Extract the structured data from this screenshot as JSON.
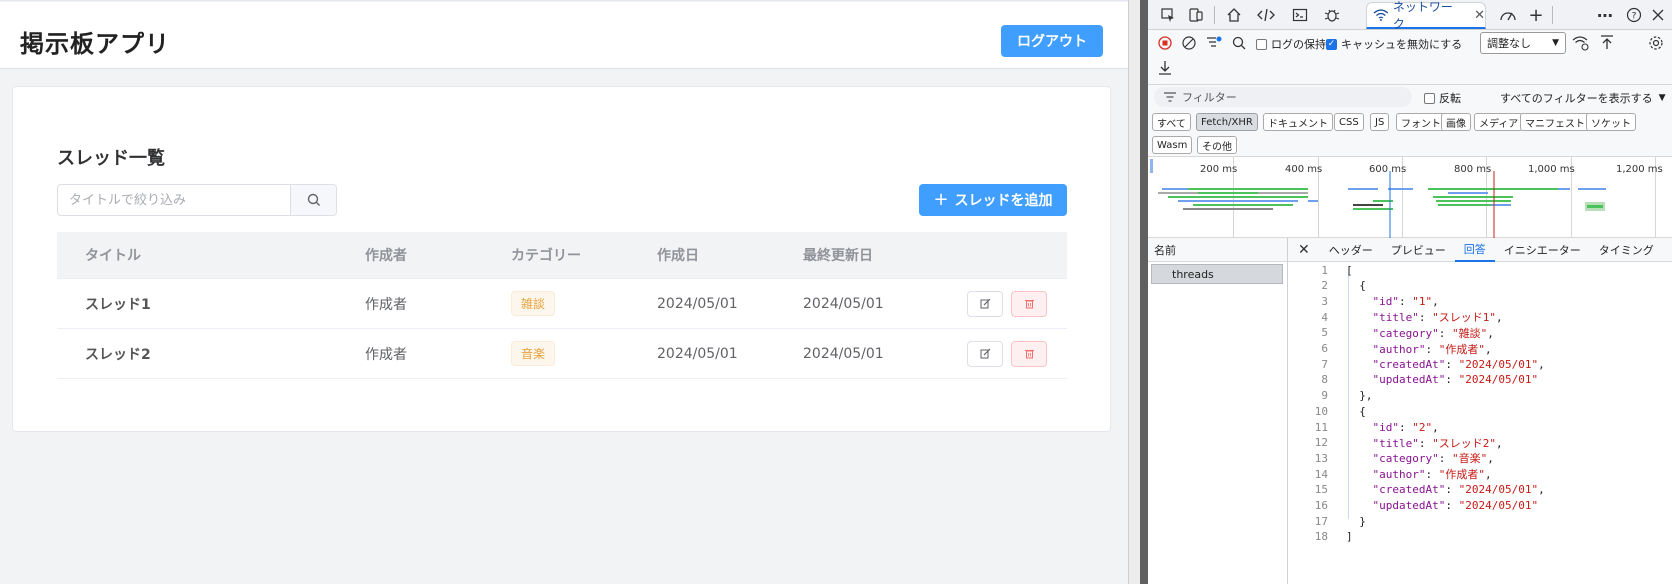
{
  "app": {
    "title": "掲示板アプリ",
    "logout_label": "ログアウト",
    "section_title": "スレッド一覧",
    "search_placeholder": "タイトルで絞り込み",
    "add_label": "スレッドを追加",
    "columns": [
      "タイトル",
      "作成者",
      "カテゴリー",
      "作成日",
      "最終更新日"
    ],
    "rows": [
      {
        "title": "スレッド1",
        "author": "作成者",
        "category": "雑談",
        "created": "2024/05/01",
        "updated": "2024/05/01"
      },
      {
        "title": "スレッド2",
        "author": "作成者",
        "category": "音楽",
        "created": "2024/05/01",
        "updated": "2024/05/01"
      }
    ],
    "accent_color": "#409eff"
  },
  "devtools": {
    "active_tab": "ネットワーク",
    "preserve_log": "ログの保持",
    "disable_cache": "キャッシュを無効にする",
    "throttle": "調整なし",
    "filter_placeholder": "フィルター",
    "invert": "反転",
    "show_all_filters": "すべてのフィルターを表示する",
    "chips": [
      "すべて",
      "Fetch/XHR",
      "ドキュメント",
      "CSS",
      "JS",
      "フォント",
      "画像",
      "メディア",
      "マニフェスト",
      "ソケット",
      "Wasm",
      "その他"
    ],
    "timeline_labels": [
      "200 ms",
      "400 ms",
      "600 ms",
      "800 ms",
      "1,000 ms",
      "1,200 ms"
    ],
    "name_header": "名前",
    "request_name": "threads",
    "detail_tabs": [
      "ヘッダー",
      "プレビュー",
      "回答",
      "イニシエーター",
      "タイミング"
    ],
    "active_detail_tab": "回答",
    "response_lines": [
      "[",
      "  {",
      "    \"id\": \"1\",",
      "    \"title\": \"スレッド1\",",
      "    \"category\": \"雑談\",",
      "    \"author\": \"作成者\",",
      "    \"createdAt\": \"2024/05/01\",",
      "    \"updatedAt\": \"2024/05/01\"",
      "  },",
      "  {",
      "    \"id\": \"2\",",
      "    \"title\": \"スレッド2\",",
      "    \"category\": \"音楽\",",
      "    \"author\": \"作成者\",",
      "    \"createdAt\": \"2024/05/01\",",
      "    \"updatedAt\": \"2024/05/01\"",
      "  }",
      "]"
    ]
  }
}
